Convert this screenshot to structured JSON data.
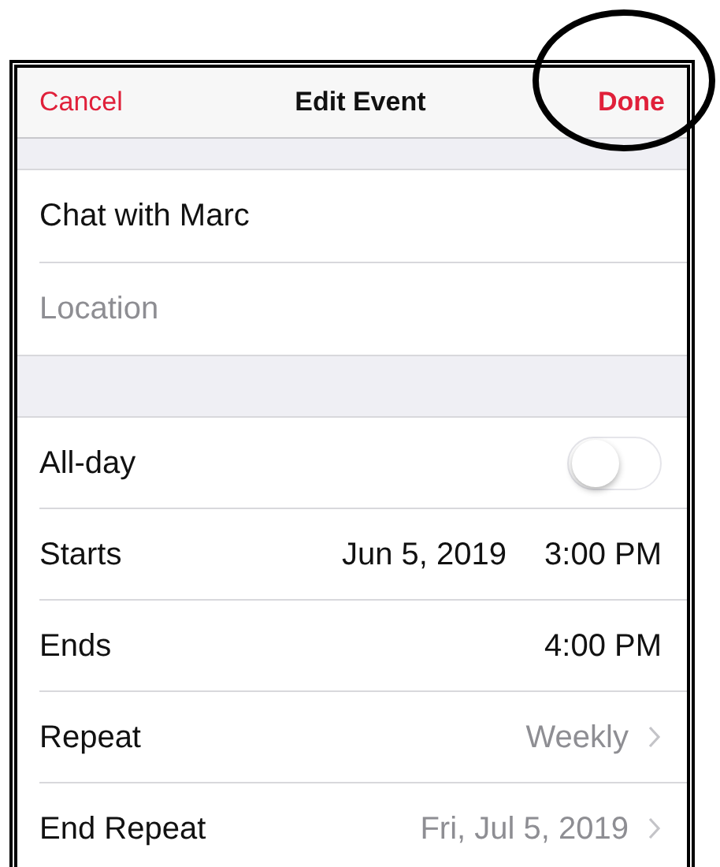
{
  "nav": {
    "cancel": "Cancel",
    "title": "Edit Event",
    "done": "Done"
  },
  "details": {
    "title_value": "Chat with Marc",
    "location_placeholder": "Location"
  },
  "rows": [
    {
      "kind": "toggle",
      "label": "All-day",
      "on": false
    },
    {
      "kind": "datetime",
      "label": "Starts",
      "date": "Jun 5, 2019",
      "time": "3:00 PM"
    },
    {
      "kind": "datetime",
      "label": "Ends",
      "time": "4:00 PM"
    },
    {
      "kind": "link",
      "label": "Repeat",
      "value": "Weekly"
    },
    {
      "kind": "link",
      "label": "End Repeat",
      "value": "Fri, Jul 5, 2019"
    }
  ]
}
